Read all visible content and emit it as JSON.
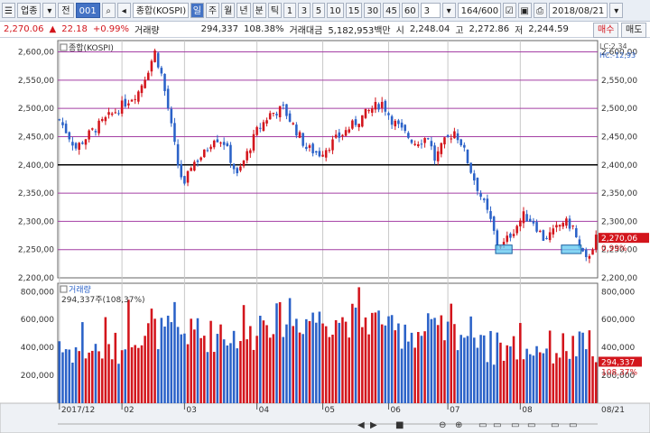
{
  "toolbar": {
    "market": "업종",
    "type": "전",
    "code": "001",
    "name": "종합(KOSPI)",
    "periods": [
      "일",
      "주",
      "월",
      "년",
      "분",
      "틱"
    ],
    "active_period": "일",
    "intervals": [
      "1",
      "3",
      "5",
      "10",
      "15",
      "30",
      "45",
      "60"
    ],
    "interval_value": "3",
    "count": "164/600",
    "date": "2018/08/21"
  },
  "quote": {
    "price": "2,270.06",
    "change": "22.18",
    "change_pct": "+0.99%",
    "volume_label": "거래량",
    "volume": "294,337",
    "volume_pct": "108.38%",
    "amount_label": "거래대금",
    "amount": "5,182,953백만",
    "open_label": "시",
    "open": "2,248.04",
    "high_label": "고",
    "high": "2,272.86",
    "low_label": "저",
    "low": "2,244.59",
    "buy_label": "매수",
    "sell_label": "매도"
  },
  "colors": {
    "up": "#d3151c",
    "down": "#2b62c8",
    "band": "#a43fa4"
  },
  "chart_data": {
    "type": "candlestick",
    "price_panel": {
      "title": "종합(KOSPI)",
      "lc": "LC:2,34",
      "hc": "HC:-12,93",
      "ylim": [
        2200,
        2620
      ],
      "yticks": [
        2200,
        2250,
        2300,
        2350,
        2400,
        2450,
        2500,
        2550,
        2600
      ],
      "ytick_labels": [
        "2,200,00",
        "2,250,00",
        "2,300,00",
        "2,350,00",
        "2,400,00",
        "2,450,00",
        "2,500,00",
        "2,550,00",
        "2,600,00"
      ],
      "reference_lines": [
        2250,
        2300,
        2350,
        2450,
        2500,
        2550,
        2600
      ],
      "base_line": 2400,
      "last_price_label": "2,270,06",
      "last_change_label": "0,99%",
      "close_waypoints": [
        [
          0,
          2480
        ],
        [
          5,
          2430
        ],
        [
          10,
          2460
        ],
        [
          16,
          2490
        ],
        [
          20,
          2510
        ],
        [
          24,
          2530
        ],
        [
          27,
          2570
        ],
        [
          29,
          2600
        ],
        [
          31,
          2560
        ],
        [
          33,
          2500
        ],
        [
          36,
          2400
        ],
        [
          38,
          2360
        ],
        [
          40,
          2400
        ],
        [
          44,
          2420
        ],
        [
          47,
          2450
        ],
        [
          50,
          2440
        ],
        [
          54,
          2380
        ],
        [
          57,
          2420
        ],
        [
          60,
          2460
        ],
        [
          64,
          2490
        ],
        [
          68,
          2500
        ],
        [
          71,
          2470
        ],
        [
          75,
          2430
        ],
        [
          79,
          2420
        ],
        [
          83,
          2440
        ],
        [
          87,
          2460
        ],
        [
          91,
          2480
        ],
        [
          95,
          2500
        ],
        [
          98,
          2510
        ],
        [
          101,
          2480
        ],
        [
          104,
          2460
        ],
        [
          108,
          2440
        ],
        [
          112,
          2450
        ],
        [
          114,
          2410
        ],
        [
          117,
          2440
        ],
        [
          120,
          2460
        ],
        [
          122,
          2440
        ],
        [
          125,
          2390
        ],
        [
          127,
          2360
        ],
        [
          129,
          2330
        ],
        [
          131,
          2300
        ],
        [
          133,
          2260
        ],
        [
          135,
          2260
        ],
        [
          138,
          2285
        ],
        [
          141,
          2310
        ],
        [
          144,
          2300
        ],
        [
          147,
          2270
        ],
        [
          150,
          2280
        ],
        [
          153,
          2300
        ],
        [
          156,
          2290
        ],
        [
          158,
          2250
        ],
        [
          160,
          2230
        ],
        [
          163,
          2270
        ]
      ],
      "boxes": [
        {
          "x": [
            133,
            138
          ],
          "y": [
            2243,
            2258
          ]
        },
        {
          "x": [
            153,
            159
          ],
          "y": [
            2243,
            2258
          ]
        }
      ]
    },
    "volume_panel": {
      "title": "거래량",
      "label": "294,337주(108,37%)",
      "ylim": [
        0,
        860000
      ],
      "yticks": [
        200000,
        400000,
        600000,
        800000
      ],
      "ytick_labels": [
        "200,000",
        "400,000",
        "600,000",
        "800,000"
      ],
      "last_volume_label": "294,337",
      "last_pct_label": "108,37%"
    },
    "x_axis": {
      "ticks": [
        {
          "i": 0,
          "label": "2017/12"
        },
        {
          "i": 19,
          "label": "02"
        },
        {
          "i": 38,
          "label": "03"
        },
        {
          "i": 60,
          "label": "04"
        },
        {
          "i": 80,
          "label": "05"
        },
        {
          "i": 100,
          "label": "06"
        },
        {
          "i": 118,
          "label": "07"
        },
        {
          "i": 140,
          "label": "08"
        }
      ],
      "right_label": "08/21"
    },
    "n_candles": 164
  }
}
